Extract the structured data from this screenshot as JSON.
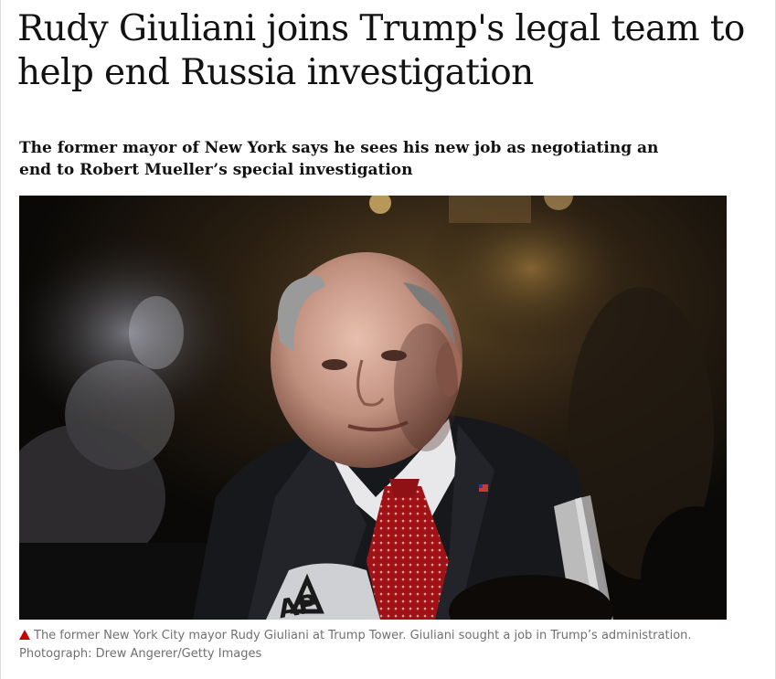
{
  "article": {
    "headline": "Rudy Giuliani joins Trump's legal team to help end Russia investigation",
    "standfirst": "The former mayor of New York says he sees his new job as negotiating an end to Robert Mueller’s special investigation"
  },
  "figure": {
    "microphone_logo_text": "AP",
    "caption_icon": "triangle-up-icon",
    "caption": "The former New York City mayor Rudy Giuliani at Trump Tower. Giuliani sought a job in Trump’s administration.",
    "credit": "Photograph: Drew Angerer/Getty Images"
  },
  "colors": {
    "text": "#121212",
    "caption_text": "#707070",
    "caption_icon": "#c70000"
  }
}
